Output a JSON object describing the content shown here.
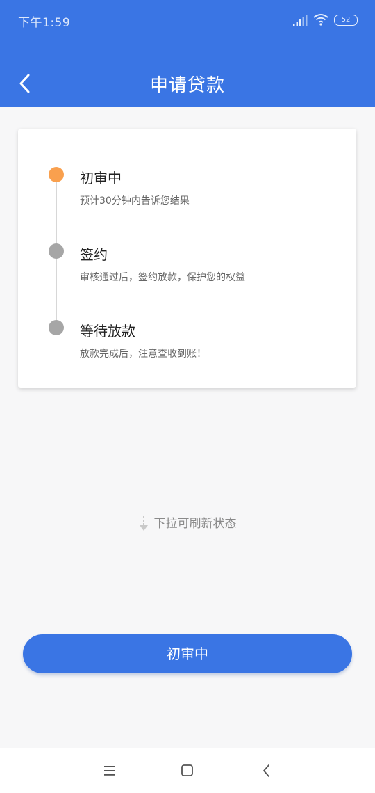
{
  "status_bar": {
    "time": "下午1:59",
    "battery": "52"
  },
  "header": {
    "title": "申请贷款",
    "back_icon": "chevron-left-icon"
  },
  "steps": [
    {
      "title": "初审中",
      "desc": "预计30分钟内告诉您结果",
      "state": "active",
      "color": "#f9a04e"
    },
    {
      "title": "签约",
      "desc": "审核通过后，签约放款，保护您的权益",
      "state": "pending",
      "color": "#a6a6a6"
    },
    {
      "title": "等待放款",
      "desc": "放款完成后，注意查收到账！",
      "state": "pending",
      "color": "#a6a6a6"
    }
  ],
  "pull_hint": {
    "text": "下拉可刷新状态",
    "icon": "arrow-down-icon"
  },
  "main_button": {
    "label": "初审中"
  },
  "colors": {
    "accent": "#3a75e4",
    "active": "#f9a04e",
    "inactive": "#a6a6a6"
  },
  "nav": {
    "icons": [
      "menu-icon",
      "home-square-icon",
      "back-chevron-icon"
    ]
  }
}
